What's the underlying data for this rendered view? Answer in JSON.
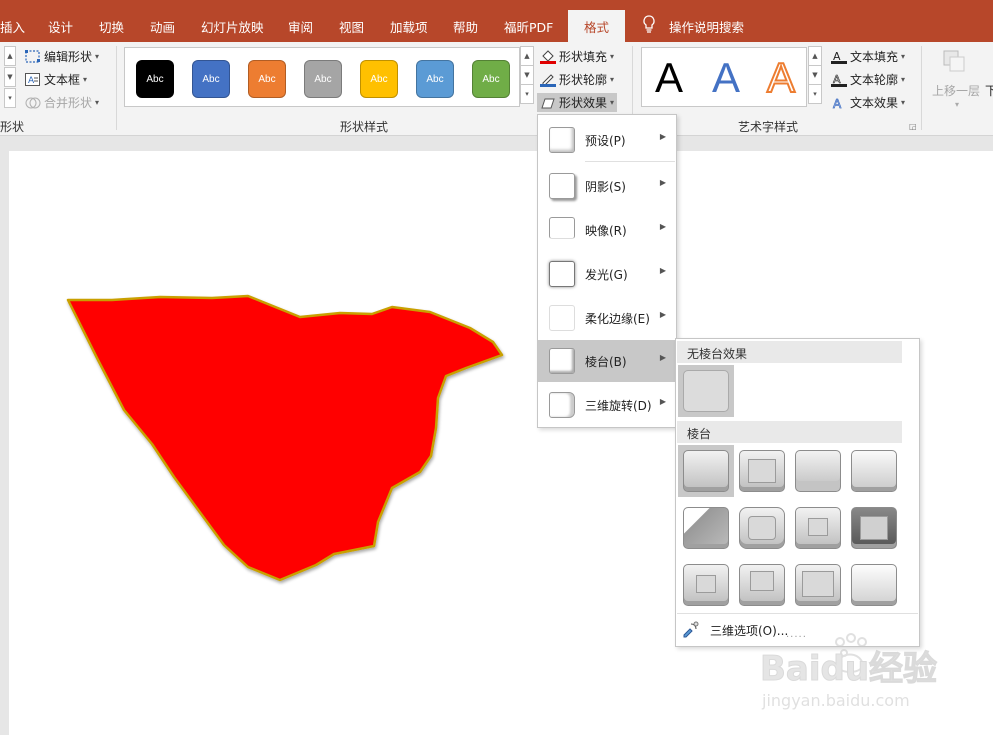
{
  "tabs": {
    "insert": "插入",
    "design": "设计",
    "transitions": "切换",
    "animations": "动画",
    "slideshow": "幻灯片放映",
    "review": "审阅",
    "view": "视图",
    "addins": "加载项",
    "help": "帮助",
    "foxit_pdf": "福昕PDF",
    "format": "格式",
    "tell_me": "操作说明搜索"
  },
  "ribbon": {
    "edit_shape": "编辑形状",
    "text_box": "文本框",
    "merge_shapes": "合并形状",
    "group_insert_shapes_partial": "形状",
    "style_swatch_text": "Abc",
    "shape_styles_label": "形状样式",
    "shape_fill": "形状填充",
    "shape_outline": "形状轮廓",
    "shape_effects": "形状效果",
    "wordart_letter": "A",
    "wordart_styles_label": "艺术字样式",
    "text_fill": "文本填充",
    "text_outline": "文本轮廓",
    "text_effects": "文本效果",
    "bring_forward": "上移一层",
    "send_backward_partial": "下"
  },
  "colors": {
    "accent_tab": "#b7472a",
    "shape_red": "#ff0000",
    "shape_outline": "#c9a000",
    "swatches": [
      "#000000",
      "#4472c4",
      "#ed7d31",
      "#a5a5a5",
      "#ffc000",
      "#5b9bd5",
      "#70ad47"
    ]
  },
  "effects_menu": {
    "items": [
      {
        "label": "预设(P)",
        "icon": "preset-icon"
      },
      {
        "label": "阴影(S)",
        "icon": "shadow-icon"
      },
      {
        "label": "映像(R)",
        "icon": "reflection-icon"
      },
      {
        "label": "发光(G)",
        "icon": "glow-icon"
      },
      {
        "label": "柔化边缘(E)",
        "icon": "soft-edges-icon"
      },
      {
        "label": "棱台(B)",
        "icon": "bevel-icon",
        "highlighted": true
      },
      {
        "label": "三维旋转(D)",
        "icon": "3d-rotation-icon"
      }
    ]
  },
  "bevel_submenu": {
    "no_bevel_header": "无棱台效果",
    "bevel_header": "棱台",
    "options_label": "三维选项(O)...",
    "resize_dots": "....."
  },
  "watermark": {
    "brand": "Baidu经验",
    "url": "jingyan.baidu.com"
  }
}
